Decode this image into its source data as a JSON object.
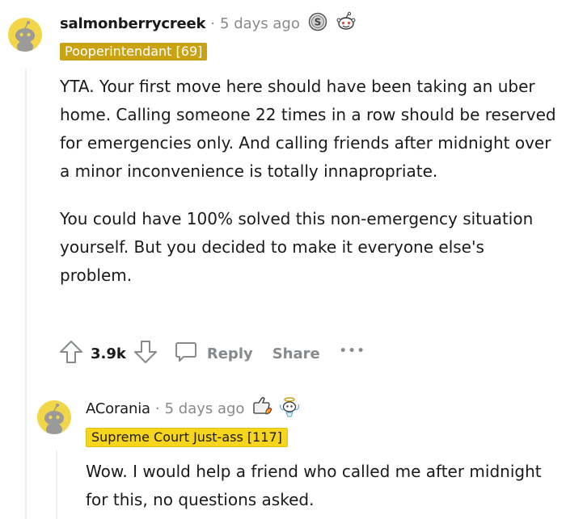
{
  "comment1": {
    "username": "salmonberrycreek",
    "separator": "·",
    "time": "5 days ago",
    "flair": {
      "text": "Pooperintendant [69]",
      "bg": "#c9a314",
      "color": "#ffffff"
    },
    "awards": [
      "silver-coin-award-icon",
      "wholesome-snoo-award-icon"
    ],
    "paragraphs": [
      "YTA. Your first move here should have been taking an uber home. Calling someone 22 times in a row should be reserved for emergencies only. And calling friends after midnight over a minor inconvenience is totally innapropriate.",
      "You could have 100% solved this non-emergency situation yourself. But you decided to make it everyone else's problem."
    ],
    "score": "3.9k",
    "reply_label": "Reply",
    "share_label": "Share",
    "more_label": "•••"
  },
  "comment2": {
    "username": "ACorania",
    "separator": "·",
    "time": "5 days ago",
    "flair": {
      "text": "Supreme Court Just-ass [117]",
      "bg": "#f7d51d",
      "color": "#1a1a1b"
    },
    "awards": [
      "helpful-hand-award-icon",
      "angel-award-icon"
    ],
    "paragraphs": [
      "Wow. I would help a friend who called me after midnight for this, no questions asked."
    ]
  }
}
